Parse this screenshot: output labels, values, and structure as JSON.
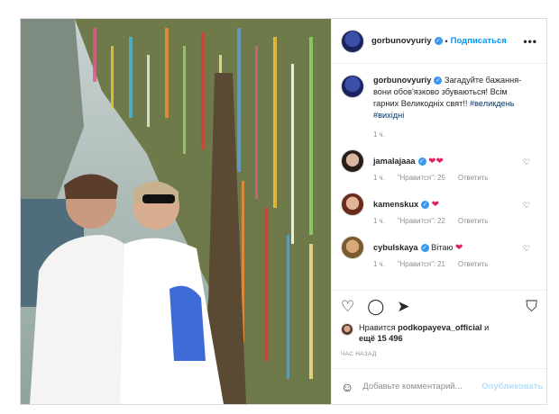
{
  "post": {
    "author": "gorbunovyuriy",
    "follow_label": "Подписаться",
    "more": "•••",
    "caption": "Загадуйте бажання-вони обов'язково збуваються! Всім гарних Великодніх свят!!",
    "hashtags": "#великдень #вихідні",
    "caption_time": "1 ч.",
    "comments": [
      {
        "user": "jamalajaaa",
        "text": "",
        "emoji": "❤❤",
        "time": "1 ч.",
        "likes": "\"Нравится\": 25",
        "reply": "Ответить"
      },
      {
        "user": "kamenskux",
        "text": "",
        "emoji": "❤",
        "time": "1 ч.",
        "likes": "\"Нравится\": 22",
        "reply": "Ответить"
      },
      {
        "user": "cybulskaya",
        "text": "Вітаю",
        "emoji": "❤",
        "time": "1 ч.",
        "likes": "\"Нравится\": 21",
        "reply": "Ответить"
      }
    ],
    "likes_prefix": "Нравится",
    "likes_user": "podkopayeva_official",
    "likes_suffix": "и",
    "likes_more": "ещё 15 496",
    "date": "час назад",
    "add_placeholder": "Добавьте комментарий...",
    "post_label": "Опубликовать"
  }
}
